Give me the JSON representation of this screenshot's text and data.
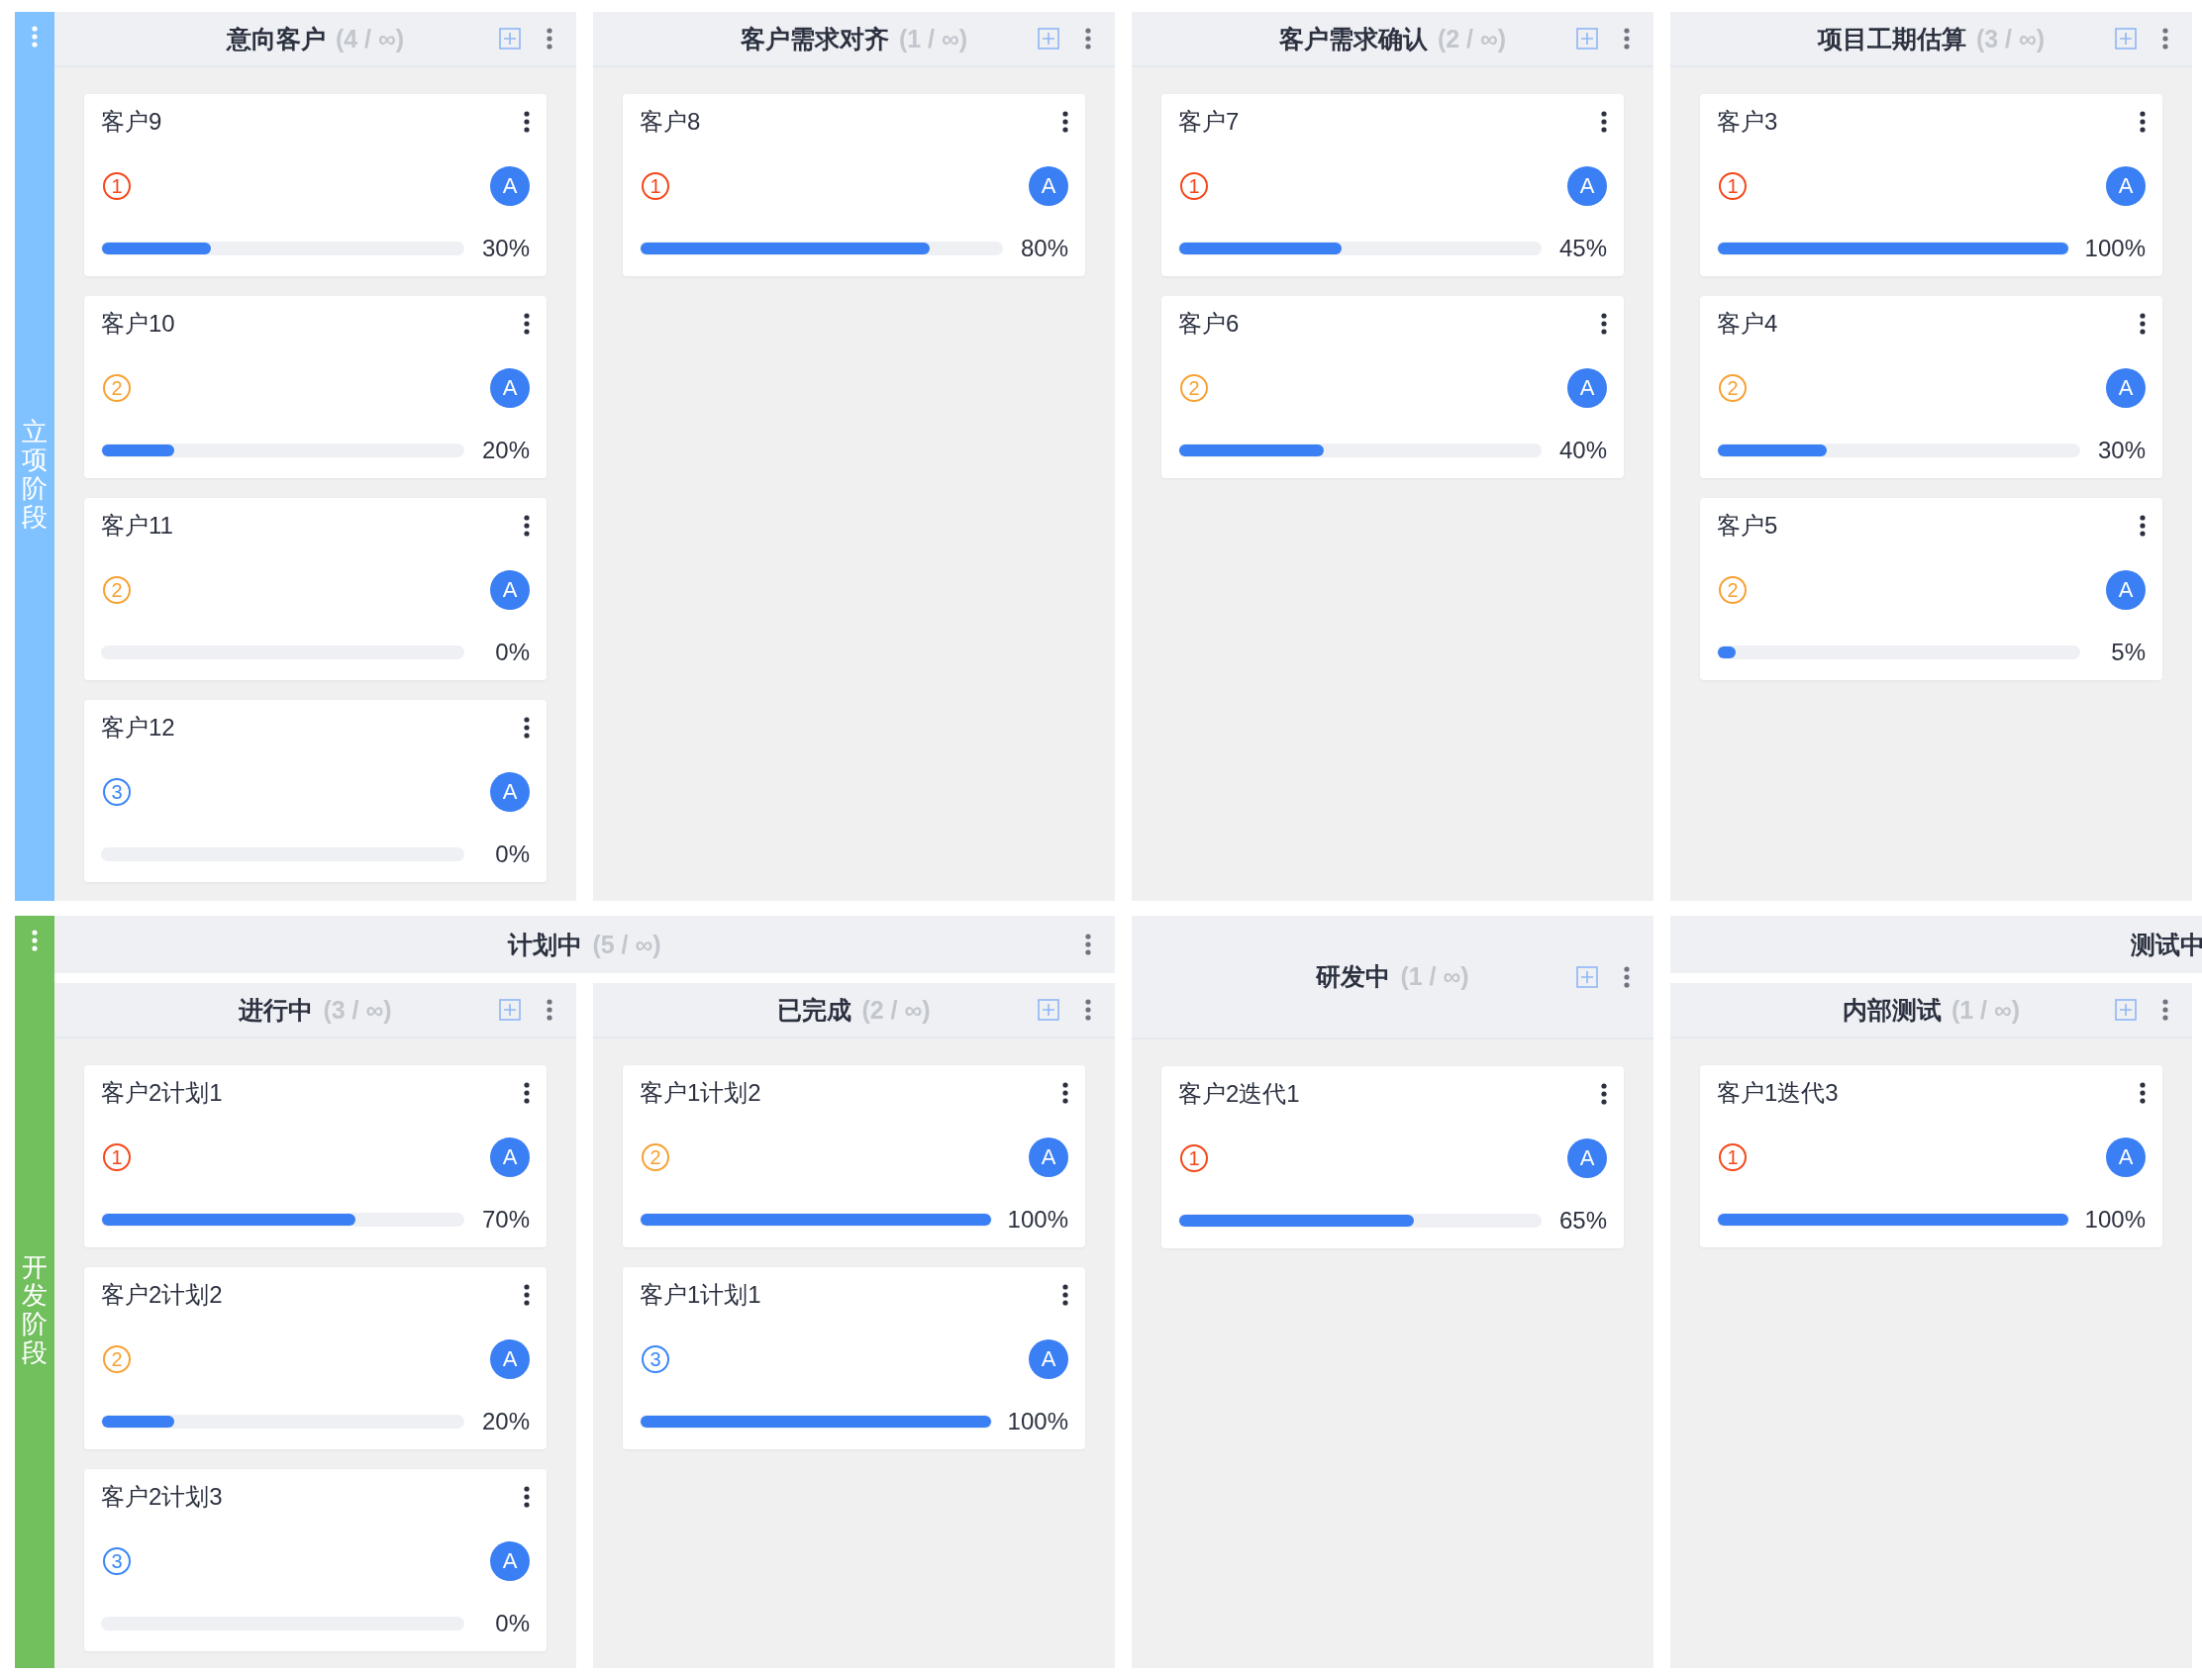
{
  "lanes": [
    {
      "title": "立项阶段",
      "color": "#7fc2ff",
      "columns": [
        {
          "kind": "column",
          "title": "意向客户",
          "count": "(4 / ∞)",
          "cards": [
            {
              "title": "客户9",
              "priority": "1",
              "color": "#f5471a",
              "avatar": "A",
              "level": 0.3,
              "reading": "30%"
            },
            {
              "title": "客户10",
              "priority": "2",
              "color": "#f7a133",
              "avatar": "A",
              "level": 0.2,
              "reading": "20%"
            },
            {
              "title": "客户11",
              "priority": "2",
              "color": "#f7a133",
              "avatar": "A",
              "level": 0,
              "reading": "0%"
            },
            {
              "title": "客户12",
              "priority": "3",
              "color": "#3a86f7",
              "avatar": "A",
              "level": 0,
              "reading": "0%"
            }
          ]
        },
        {
          "kind": "column",
          "title": "客户需求对齐",
          "count": "(1 / ∞)",
          "cards": [
            {
              "title": "客户8",
              "priority": "1",
              "color": "#f5471a",
              "avatar": "A",
              "level": 0.8,
              "reading": "80%"
            }
          ]
        },
        {
          "kind": "column",
          "title": "客户需求确认",
          "count": "(2 / ∞)",
          "cards": [
            {
              "title": "客户7",
              "priority": "1",
              "color": "#f5471a",
              "avatar": "A",
              "level": 0.45,
              "reading": "45%"
            },
            {
              "title": "客户6",
              "priority": "2",
              "color": "#f7a133",
              "avatar": "A",
              "level": 0.4,
              "reading": "40%"
            }
          ]
        },
        {
          "kind": "column",
          "title": "项目工期估算",
          "count": "(3 / ∞)",
          "cards": [
            {
              "title": "客户3",
              "priority": "1",
              "color": "#f5471a",
              "avatar": "A",
              "level": 1,
              "reading": "100%"
            },
            {
              "title": "客户4",
              "priority": "2",
              "color": "#f7a133",
              "avatar": "A",
              "level": 0.3,
              "reading": "30%"
            },
            {
              "title": "客户5",
              "priority": "2",
              "color": "#f7a133",
              "avatar": "A",
              "level": 0.05,
              "reading": "5%"
            }
          ]
        }
      ]
    },
    {
      "title": "开发阶段",
      "color": "#72bf5e",
      "columns": [
        {
          "kind": "group",
          "title": "计划中",
          "count": "(5 / ∞)",
          "menu": true,
          "children": [
            {
              "kind": "column",
              "title": "进行中",
              "count": "(3 / ∞)",
              "cards": [
                {
                  "title": "客户2计划1",
                  "priority": "1",
                  "color": "#f5471a",
                  "avatar": "A",
                  "level": 0.7,
                  "reading": "70%"
                },
                {
                  "title": "客户2计划2",
                  "priority": "2",
                  "color": "#f7a133",
                  "avatar": "A",
                  "level": 0.2,
                  "reading": "20%"
                },
                {
                  "title": "客户2计划3",
                  "priority": "3",
                  "color": "#3a86f7",
                  "avatar": "A",
                  "level": 0,
                  "reading": "0%"
                }
              ]
            },
            {
              "kind": "column",
              "title": "已完成",
              "count": "(2 / ∞)",
              "cards": [
                {
                  "title": "客户1计划2",
                  "priority": "2",
                  "color": "#f7a133",
                  "avatar": "A",
                  "level": 1,
                  "reading": "100%"
                },
                {
                  "title": "客户1计划1",
                  "priority": "3",
                  "color": "#3a86f7",
                  "avatar": "A",
                  "level": 1,
                  "reading": "100%"
                }
              ]
            }
          ]
        },
        {
          "kind": "column",
          "title": "研发中",
          "count": "(1 / ∞)",
          "cards": [
            {
              "title": "客户2迭代1",
              "priority": "1",
              "color": "#f5471a",
              "avatar": "A",
              "level": 0.65,
              "reading": "65%"
            }
          ]
        },
        {
          "kind": "group",
          "title": "测试中",
          "menu": false,
          "children": [
            {
              "kind": "column",
              "title": "内部测试",
              "count": "(1 / ∞)",
              "cards": [
                {
                  "title": "客户1迭代3",
                  "priority": "1",
                  "color": "#f5471a",
                  "avatar": "A",
                  "level": 1,
                  "reading": "100%"
                }
              ]
            }
          ]
        }
      ]
    }
  ]
}
